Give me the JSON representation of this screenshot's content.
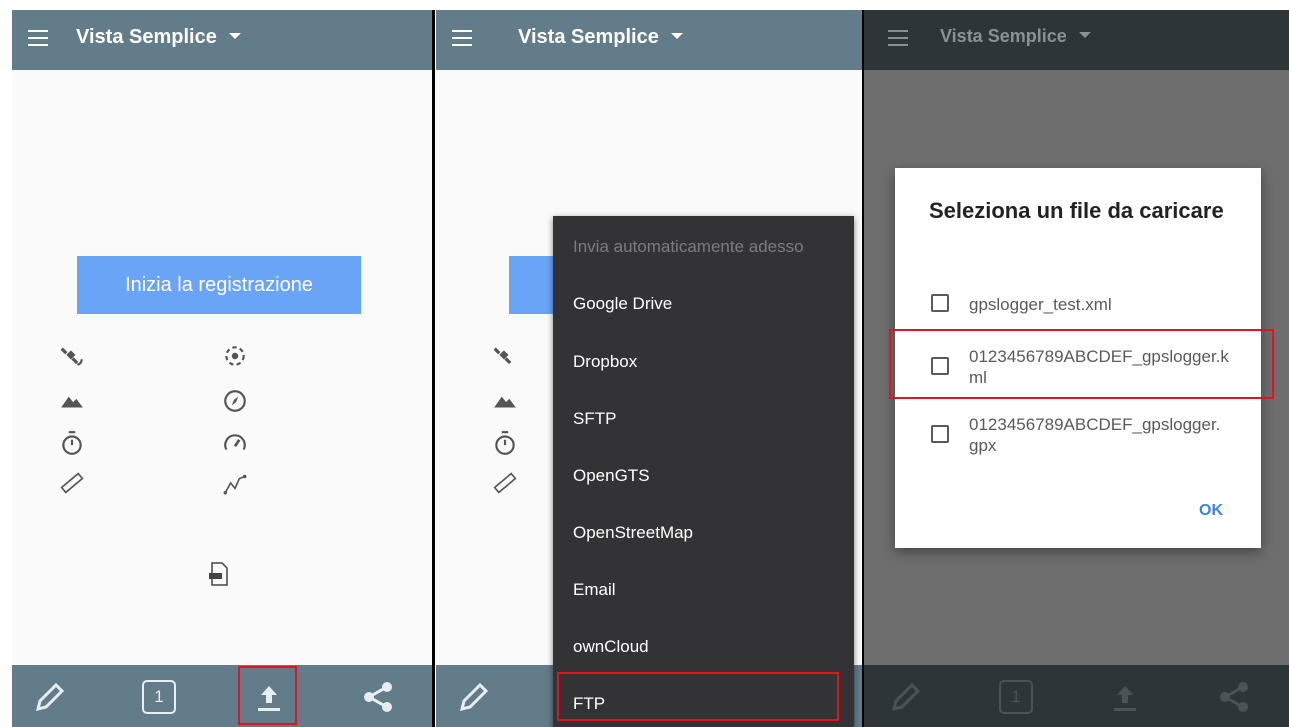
{
  "colors": {
    "accent": "#627c8a",
    "button": "#6aa4f7",
    "highlight": "#e0141e",
    "menu_bg": "#333335",
    "ok": "#3a82e0"
  },
  "appbar": {
    "title": "Vista Semplice",
    "title_dialog_overlap": "Vista Semplice"
  },
  "main": {
    "start_label": "Inizia la registrazione"
  },
  "stats_icons": [
    "satellite-icon",
    "gps-fix-icon",
    "mountain-icon",
    "compass-icon",
    "stopwatch-icon",
    "speedometer-icon",
    "ruler-icon",
    "route-icon"
  ],
  "bottom_nav": {
    "annotate": "pencil-icon",
    "count": "1",
    "upload": "upload-icon",
    "share": "share-icon"
  },
  "upload_menu": {
    "items": [
      {
        "label": "Invia automaticamente adesso",
        "enabled": false
      },
      {
        "label": "Google Drive",
        "enabled": true
      },
      {
        "label": "Dropbox",
        "enabled": true
      },
      {
        "label": "SFTP",
        "enabled": true
      },
      {
        "label": "OpenGTS",
        "enabled": true
      },
      {
        "label": "OpenStreetMap",
        "enabled": true
      },
      {
        "label": "Email",
        "enabled": true
      },
      {
        "label": "ownCloud",
        "enabled": true
      },
      {
        "label": "FTP",
        "enabled": true
      }
    ]
  },
  "dialog": {
    "title": "Seleziona un file da caricare",
    "files": [
      {
        "name": "gpslogger_test.xml",
        "checked": false
      },
      {
        "name": "0123456789ABCDEF_gpslogger.kml",
        "checked": false
      },
      {
        "name": "0123456789ABCDEF_gpslogger.gpx",
        "checked": false
      }
    ],
    "ok_label": "OK"
  }
}
